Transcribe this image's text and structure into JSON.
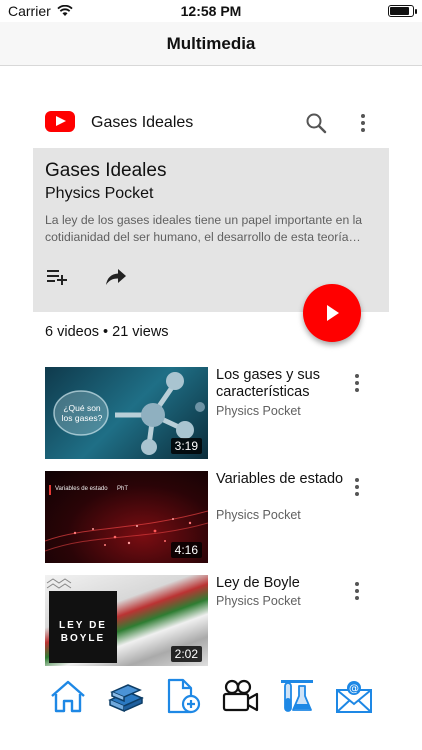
{
  "status_bar": {
    "carrier": "Carrier",
    "time": "12:58 PM"
  },
  "nav": {
    "title": "Multimedia"
  },
  "youtube": {
    "header_title": "Gases Ideales",
    "playlist_title": "Gases Ideales",
    "channel": "Physics Pocket",
    "description": "La ley de los gases ideales tiene un papel importante en la cotidianidad del ser humano, el desarrollo de esta teoría…",
    "meta": "6 videos • 21 views",
    "videos": [
      {
        "title": "Los gases y sus características",
        "channel": "Physics Pocket",
        "duration": "3:19",
        "thumb_text": "¿Qué son los gases?"
      },
      {
        "title": "Variables de estado",
        "channel": "Physics Pocket",
        "duration": "4:16",
        "thumb_text": "Variables de estado",
        "thumb_brand": "PhT"
      },
      {
        "title": "Ley de Boyle",
        "channel": "Physics Pocket",
        "duration": "2:02",
        "thumb_text": "LEY DE BOYLE"
      }
    ]
  },
  "tabbar": {
    "accent": "#1e88e5",
    "icons": [
      "home-icon",
      "books-icon",
      "add-document-icon",
      "video-camera-icon",
      "lab-icon",
      "email-icon"
    ]
  }
}
